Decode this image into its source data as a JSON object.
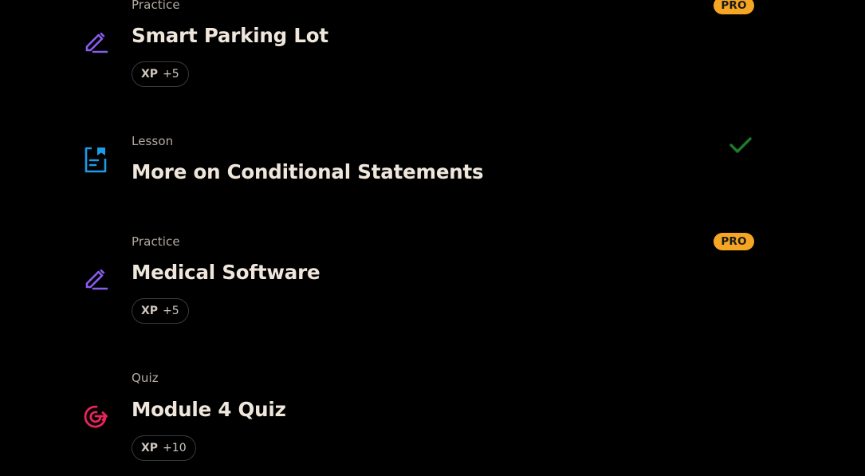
{
  "colors": {
    "background": "#000000",
    "practice_icon": "#8a5cf0",
    "lesson_icon": "#1e9be8",
    "quiz_icon": "#e8245a",
    "pro_badge": "#f5a524",
    "check": "#1f7a2a"
  },
  "items": [
    {
      "type": "Practice",
      "title": "Smart Parking Lot",
      "icon": "pencil-icon",
      "xp_label": "XP",
      "xp_value": "+5",
      "badge": "PRO"
    },
    {
      "type": "Lesson",
      "title": "More on Conditional Statements",
      "icon": "document-icon",
      "completed": true,
      "status_icon": "checkmark-icon"
    },
    {
      "type": "Practice",
      "title": "Medical Software",
      "icon": "pencil-icon",
      "xp_label": "XP",
      "xp_value": "+5",
      "badge": "PRO"
    },
    {
      "type": "Quiz",
      "title": "Module 4 Quiz",
      "icon": "target-icon",
      "xp_label": "XP",
      "xp_value": "+10"
    }
  ]
}
